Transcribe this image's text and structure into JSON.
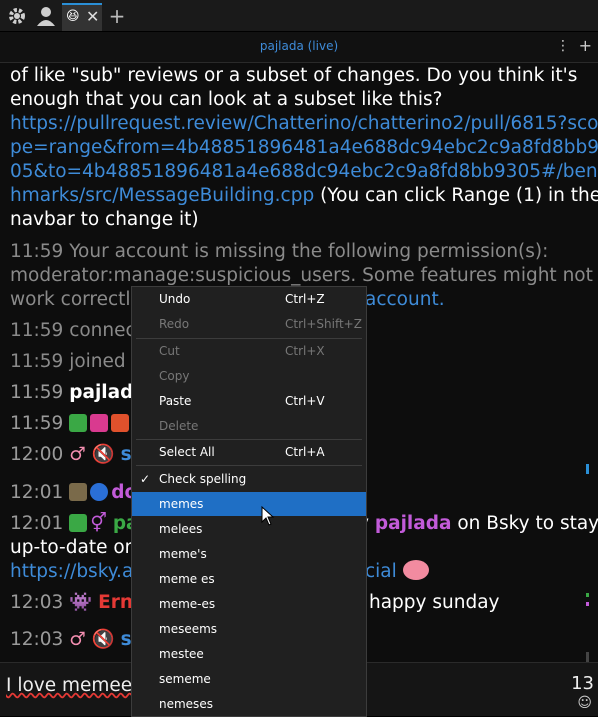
{
  "tabs": {
    "current_emoji": "😆"
  },
  "header": {
    "title": "pajlada (live)",
    "menu_glyph": "⋮"
  },
  "messages": {
    "m1_text": "of like \"sub\" reviews or a subset of changes. Do you think it's",
    "m2_text": "enough that you can look at a subset like this?",
    "link1": "https://pullrequest.review/Chatterino/chatterino2/pull/6815?sco",
    "link2": "pe=range&from=4b48851896481a4e688dc94ebc2c9a8fd8bb93",
    "link3": "05&to=4b48851896481a4e688dc94ebc2c9a8fd8bb9305#/benc",
    "link4": "hmarks/src/MessageBuilding.cpp",
    "link4_after": " (You can click Range (1) in the",
    "m5_text": "navbar to change it)",
    "sys1_line1": "11:59 Your account is missing the following permission(s):",
    "sys1_line2": "moderator:manage:suspicious_users. Some features might not",
    "sys1_line3": "work correctly",
    "sys1_link": "account.",
    "r_connect": "11:59 connect",
    "r_joined": "11:59 joined c",
    "r_pajlada_ts": "11:59",
    "r_pajlada_name": "pajlada",
    "r_badges_ts": "11:59",
    "r_badges_tail": "!",
    "r_st1_ts": "12:00",
    "r_st1_name": "st",
    "r_do_ts": "12:01",
    "r_do_name": "do",
    "r_pa_ts": "12:01",
    "r_pa_name": "pa",
    "r_pa_tail_pre": "y ",
    "r_pa_tail_name": "pajlada",
    "r_pa_tail": " on Bsky to stay",
    "r_upto": "up-to-date on",
    "r_bsky_link": "https://bsky.a",
    "r_bsky_tail": "cial",
    "r_erne_ts": "12:03",
    "r_erne_name": "Erne",
    "r_erne_tail": "happy sunday",
    "r_st2_ts": "12:03",
    "r_st2_name": "st"
  },
  "input": {
    "text": "I love memees",
    "char_count": "13",
    "emoji_glyph": "☺"
  },
  "context_menu": {
    "undo": "Undo",
    "undo_sc": "Ctrl+Z",
    "redo": "Redo",
    "redo_sc": "Ctrl+Shift+Z",
    "cut": "Cut",
    "cut_sc": "Ctrl+X",
    "copy": "Copy",
    "paste": "Paste",
    "paste_sc": "Ctrl+V",
    "delete": "Delete",
    "select_all": "Select All",
    "select_all_sc": "Ctrl+A",
    "check_spelling": "Check spelling",
    "suggestions": [
      "memes",
      "melees",
      "meme's",
      "meme es",
      "meme-es",
      "meseems",
      "mestee",
      "sememe",
      "nemeses"
    ]
  },
  "colors": {
    "accent": "#1f6fc5",
    "link": "#3e8bd8",
    "pajlada_mention": "#c25bd9",
    "erne": "#e53935"
  }
}
